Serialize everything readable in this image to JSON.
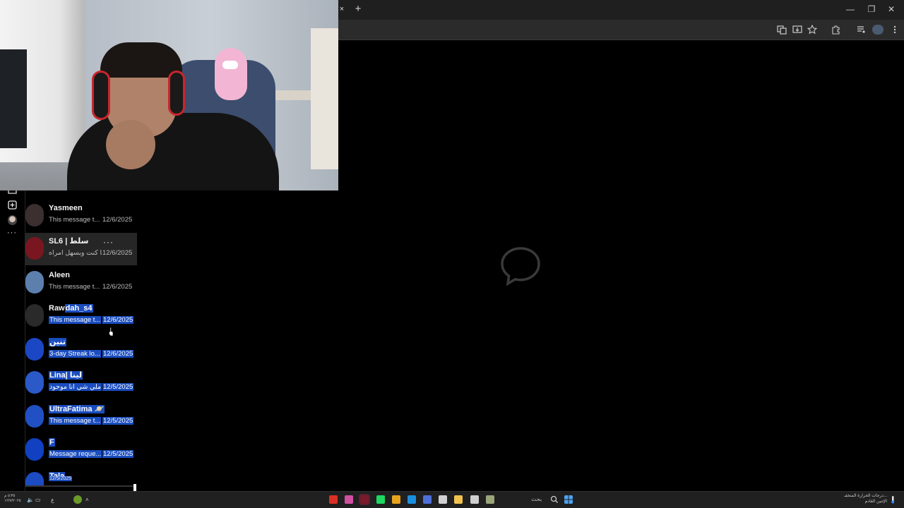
{
  "browser": {
    "tab_close": "×",
    "new_tab": "+",
    "window_controls": {
      "minimize": "—",
      "restore": "❐",
      "close": "✕"
    },
    "toolbar_icons": [
      "translate-icon",
      "install-icon",
      "star-icon",
      "extensions-icon",
      "media-icon",
      "profile-icon",
      "menu-icon"
    ]
  },
  "rail": {
    "icons": [
      "inbox-icon",
      "new-message-icon",
      "avatar",
      "more-icon"
    ],
    "more_label": "···"
  },
  "conversations": [
    {
      "name": "Yasmeen",
      "preview": "This message t...",
      "date": "12/6/2025",
      "avatar_color": "#3b2f2f",
      "selected": false,
      "hover": false
    },
    {
      "name": "SL6 | سلط",
      "preview": "ما كنت وبسهل امراه ...",
      "date": "12/6/2025",
      "avatar_color": "#7a1620",
      "selected": false,
      "hover": true,
      "more": "···"
    },
    {
      "name": "Aleen",
      "preview": "This message t...",
      "date": "12/6/2025",
      "avatar_color": "#5d7fae",
      "selected": false,
      "hover": false
    },
    {
      "name": "Rawdah_s4",
      "name_plain": "Raw",
      "name_sel": "dah_s4",
      "preview": "This message t...",
      "date": "12/6/2025",
      "avatar_color": "#2a2a2a",
      "selected": true,
      "partial": true,
      "hover": false
    },
    {
      "name": "تنين",
      "preview": "3-day Streak lo...",
      "date": "12/6/2025",
      "avatar_color": "#1b47c4",
      "selected": true,
      "hover": false
    },
    {
      "name": "Lina| لينا",
      "preview": "بي ملي شي انا موجود ...",
      "date": "12/5/2025",
      "avatar_color": "#2b59c8",
      "selected": true,
      "hover": false
    },
    {
      "name": "UltraFatima 🪐",
      "preview": "This message t...",
      "date": "12/5/2025",
      "avatar_color": "#2150c4",
      "selected": true,
      "hover": false
    },
    {
      "name": "F",
      "preview": "Message reque...",
      "date": "12/5/2025",
      "avatar_color": "#1140c0",
      "selected": true,
      "hover": false
    },
    {
      "name": "Tala",
      "preview": "",
      "date": "12/5/2025",
      "avatar_color": "#1d4cc2",
      "selected": true,
      "hover": false
    }
  ],
  "taskbar": {
    "search_placeholder": "بحث",
    "clock_time": "٥:٣٥ م",
    "clock_date": "١٢/٧/٢٠٢٥",
    "weather_line1": "درجات الحرارة المنخفـ...",
    "weather_line2": "الإثنين القادم",
    "apps": [
      "chrome-icon",
      "discord-icon",
      "terminal-icon",
      "spotify-icon",
      "chrome-alt-icon",
      "edge-icon",
      "vscode-icon",
      "calendar-icon",
      "folder-icon",
      "notepad-icon",
      "settings-icon",
      "start-icon"
    ]
  }
}
